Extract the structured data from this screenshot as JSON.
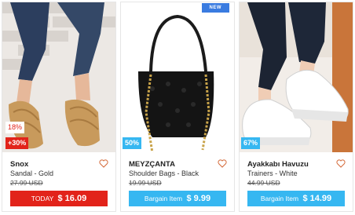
{
  "products": [
    {
      "brand": "Snox",
      "name": "Sandal - Gold",
      "old_price": "27.99 USD",
      "top_badge": "18%",
      "discount_badge": "+30%",
      "cta_label": "TODAY",
      "cta_price": "$ 16.09",
      "cta_color": "#e2231a"
    },
    {
      "brand": "MEYZÇANTA",
      "name": "Shoulder Bags - Black",
      "old_price": "19.99 USD",
      "new_badge": "NEW",
      "discount_badge": "50%",
      "cta_label": "Bargain Item",
      "cta_price": "$ 9.99",
      "cta_color": "#36b7f1"
    },
    {
      "brand": "Ayakkabı Havuzu",
      "name": "Trainers - White",
      "old_price": "44.99 USD",
      "discount_badge": "67%",
      "cta_label": "Bargain Item",
      "cta_price": "$ 14.99",
      "cta_color": "#36b7f1"
    }
  ],
  "icons": {
    "favorite": "heart-outline-icon"
  }
}
